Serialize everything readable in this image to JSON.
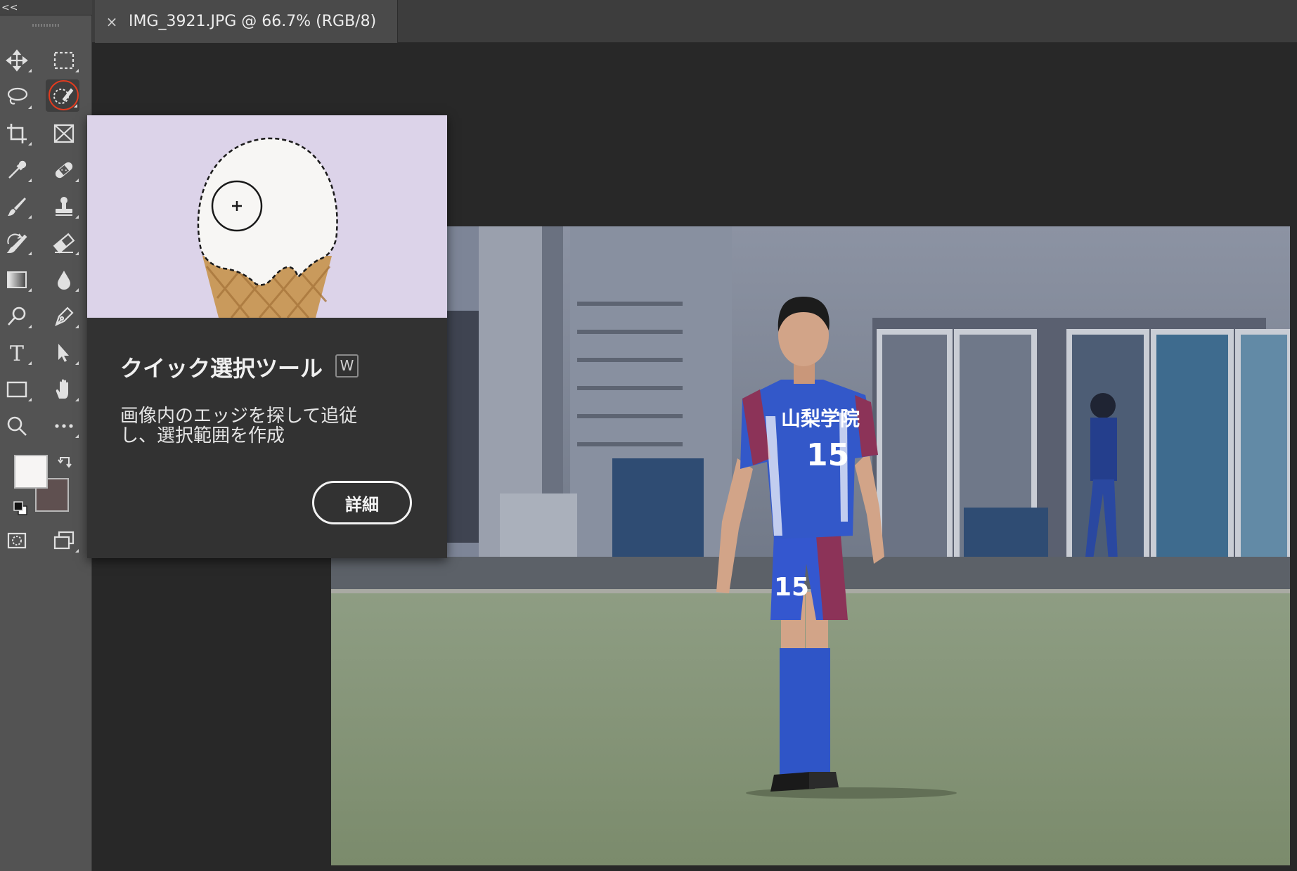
{
  "toolbar": {
    "collapse_label": "<<",
    "tools": [
      {
        "name": "move-tool",
        "icon": "move-icon"
      },
      {
        "name": "rectangular-marquee-tool",
        "icon": "marquee-icon"
      },
      {
        "name": "lasso-tool",
        "icon": "lasso-icon"
      },
      {
        "name": "quick-selection-tool",
        "icon": "quick-selection-icon",
        "active": true
      },
      {
        "name": "crop-tool",
        "icon": "crop-icon"
      },
      {
        "name": "frame-tool",
        "icon": "frame-icon"
      },
      {
        "name": "eyedropper-tool",
        "icon": "eyedropper-icon"
      },
      {
        "name": "spot-healing-tool",
        "icon": "bandage-icon"
      },
      {
        "name": "brush-tool",
        "icon": "brush-icon"
      },
      {
        "name": "clone-stamp-tool",
        "icon": "stamp-icon"
      },
      {
        "name": "history-brush-tool",
        "icon": "history-brush-icon"
      },
      {
        "name": "eraser-tool",
        "icon": "eraser-icon"
      },
      {
        "name": "gradient-tool",
        "icon": "gradient-icon"
      },
      {
        "name": "blur-tool",
        "icon": "drop-icon"
      },
      {
        "name": "dodge-tool",
        "icon": "dodge-icon"
      },
      {
        "name": "pen-tool",
        "icon": "pen-icon"
      },
      {
        "name": "type-tool",
        "icon": "type-icon"
      },
      {
        "name": "path-selection-tool",
        "icon": "arrow-icon"
      },
      {
        "name": "rectangle-tool",
        "icon": "rectangle-icon"
      },
      {
        "name": "hand-tool",
        "icon": "hand-icon"
      },
      {
        "name": "zoom-tool",
        "icon": "zoom-icon"
      },
      {
        "name": "edit-toolbar",
        "icon": "more-icon"
      },
      {
        "name": "quick-mask-mode",
        "icon": "quick-mask-icon"
      },
      {
        "name": "screen-mode",
        "icon": "screen-mode-icon"
      }
    ],
    "foreground_color": "#f7f5f4",
    "background_color": "#5f5050"
  },
  "tab": {
    "close_label": "×",
    "title": "IMG_3921.JPG @ 66.7% (RGB/8)"
  },
  "tooltip": {
    "title": "クイック選択ツール",
    "shortcut": "W",
    "description": "画像内のエッジを探して追従し、選択範囲を作成",
    "button_label": "詳細"
  },
  "photo": {
    "jersey_text": "山梨学院",
    "jersey_number": "15"
  },
  "colors": {
    "toolbar_bg": "#535353",
    "workspace_bg": "#282828",
    "tooltip_bg": "#323232",
    "active_ring": "#e23b1f",
    "illustration_bg": "#dcd3e9"
  }
}
